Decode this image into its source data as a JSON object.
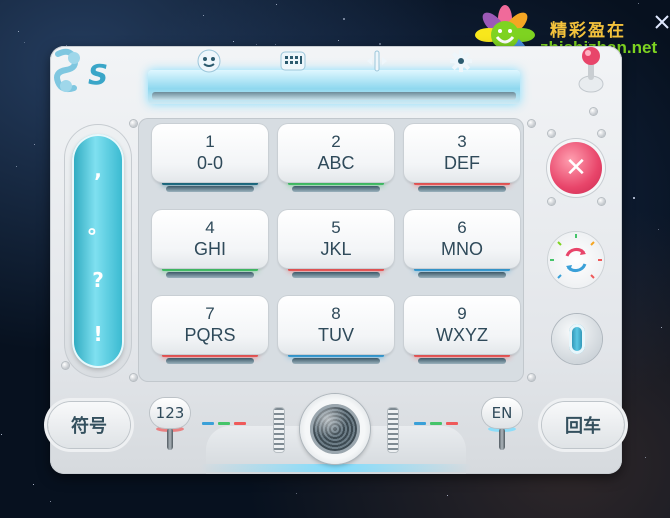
{
  "watermark": {
    "chinese_text": "精彩盈在",
    "site": "zhishizhan.net"
  },
  "toolbar": {
    "icons": [
      "smiley-icon",
      "keyboard-icon",
      "text-cursor-icon",
      "gear-icon"
    ]
  },
  "logo": {
    "letter": "S"
  },
  "punctuation": [
    ",",
    "。",
    "?",
    "!"
  ],
  "keys": [
    {
      "num": "1",
      "letters": "0-0",
      "glow": "#1f6f86"
    },
    {
      "num": "2",
      "letters": "ABC",
      "glow": "#45c46a"
    },
    {
      "num": "3",
      "letters": "DEF",
      "glow": "#ef5a5a"
    },
    {
      "num": "4",
      "letters": "GHI",
      "glow": "#45c46a"
    },
    {
      "num": "5",
      "letters": "JKL",
      "glow": "#ef5a5a"
    },
    {
      "num": "6",
      "letters": "MNO",
      "glow": "#3aa0d8"
    },
    {
      "num": "7",
      "letters": "PQRS",
      "glow": "#ef5a5a"
    },
    {
      "num": "8",
      "letters": "TUV",
      "glow": "#3aa0d8"
    },
    {
      "num": "9",
      "letters": "WXYZ",
      "glow": "#ef5a5a"
    }
  ],
  "right_controls": {
    "delete_symbol": "✕",
    "refresh_icon": "refresh-icon",
    "switch_icon": "switch-icon"
  },
  "bottom": {
    "symbol_label": "符号",
    "numeric_mode_label": "123",
    "english_mode_label": "EN",
    "enter_label": "回车",
    "mic_icon": "microphone-icon"
  },
  "colors": {
    "accent_teal": "#36b8cf",
    "delete_pink": "#e8456a",
    "glow_cyan": "#78dcff",
    "dash_colors": [
      "#3aa0d8",
      "#45c46a",
      "#ef5a5a"
    ]
  }
}
